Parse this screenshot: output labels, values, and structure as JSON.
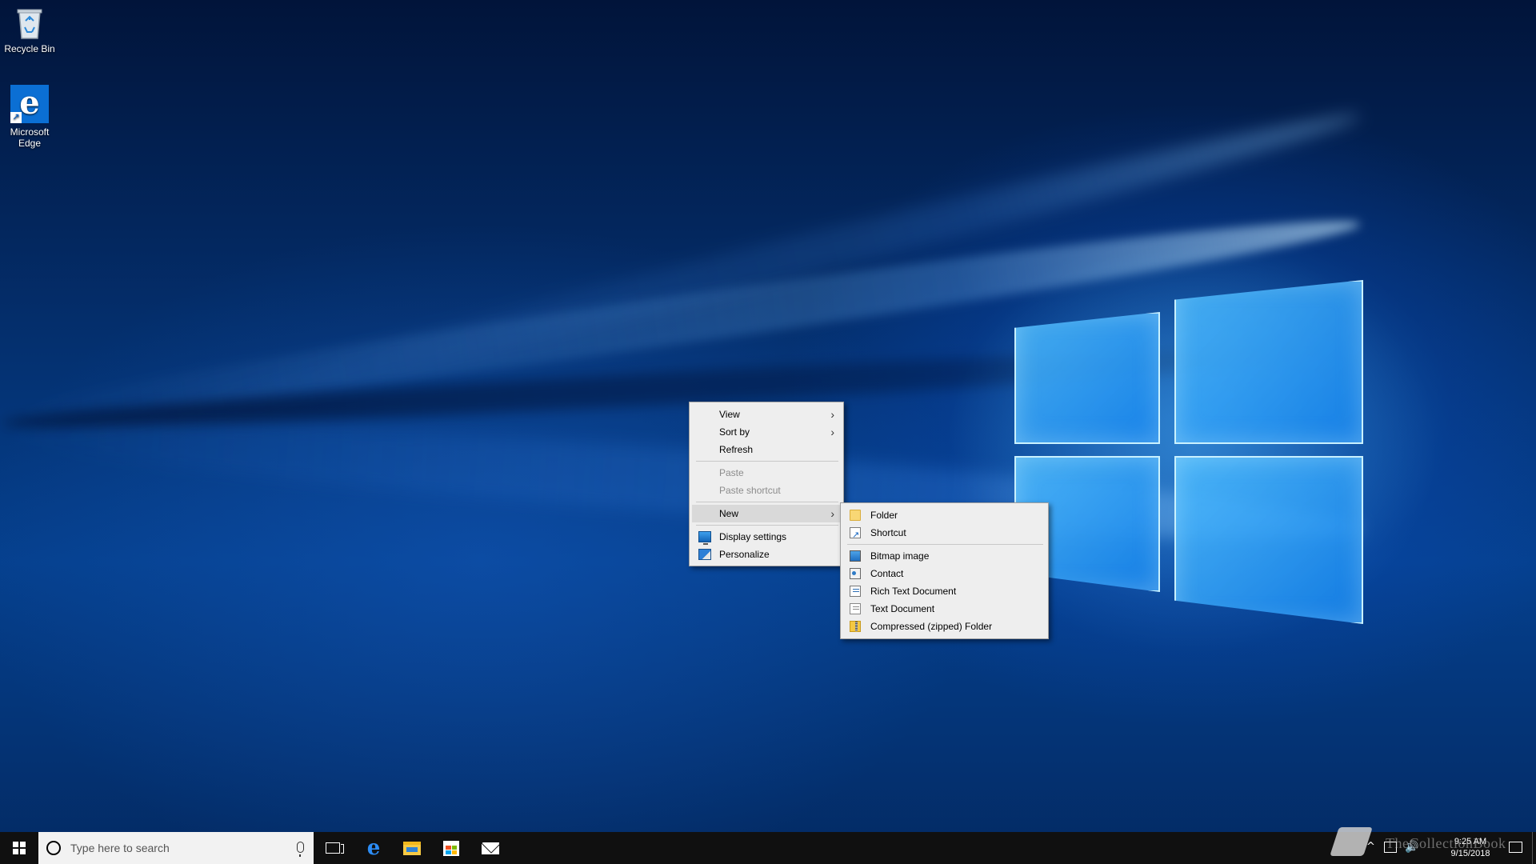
{
  "desktop": {
    "icons": [
      {
        "label": "Recycle Bin",
        "icon": "recycle-bin-icon"
      },
      {
        "label": "Microsoft Edge",
        "icon": "edge-icon"
      }
    ]
  },
  "context_menu": {
    "items": [
      {
        "label": "View",
        "has_submenu": true,
        "enabled": true
      },
      {
        "label": "Sort by",
        "has_submenu": true,
        "enabled": true
      },
      {
        "label": "Refresh",
        "has_submenu": false,
        "enabled": true
      },
      {
        "label": "Paste",
        "has_submenu": false,
        "enabled": false
      },
      {
        "label": "Paste shortcut",
        "has_submenu": false,
        "enabled": false
      },
      {
        "label": "New",
        "has_submenu": true,
        "enabled": true,
        "highlighted": true
      },
      {
        "label": "Display settings",
        "icon": "display-settings-icon",
        "enabled": true
      },
      {
        "label": "Personalize",
        "icon": "personalize-icon",
        "enabled": true
      }
    ],
    "arrow_glyph": "›"
  },
  "new_submenu": {
    "items": [
      {
        "label": "Folder",
        "icon": "folder-icon"
      },
      {
        "label": "Shortcut",
        "icon": "shortcut-icon"
      },
      {
        "label": "Bitmap image",
        "icon": "bitmap-icon"
      },
      {
        "label": "Contact",
        "icon": "contact-icon"
      },
      {
        "label": "Rich Text Document",
        "icon": "rich-text-icon"
      },
      {
        "label": "Text Document",
        "icon": "text-document-icon"
      },
      {
        "label": "Compressed (zipped) Folder",
        "icon": "zip-folder-icon"
      }
    ]
  },
  "taskbar": {
    "search_placeholder": "Type here to search",
    "pinned": [
      "task-view",
      "microsoft-edge",
      "file-explorer",
      "microsoft-store",
      "mail"
    ],
    "clock": {
      "time": "9:25 AM",
      "date": "9/15/2018"
    },
    "tray_chevron": "^",
    "volume_glyph": "🔊"
  },
  "watermark": {
    "text": "TheCollectionBook"
  },
  "colors": {
    "taskbar": "#101010",
    "menu_bg": "#eeeeee",
    "menu_highlight": "#d9d9d9",
    "wallpaper_accent": "#1e88e5"
  }
}
